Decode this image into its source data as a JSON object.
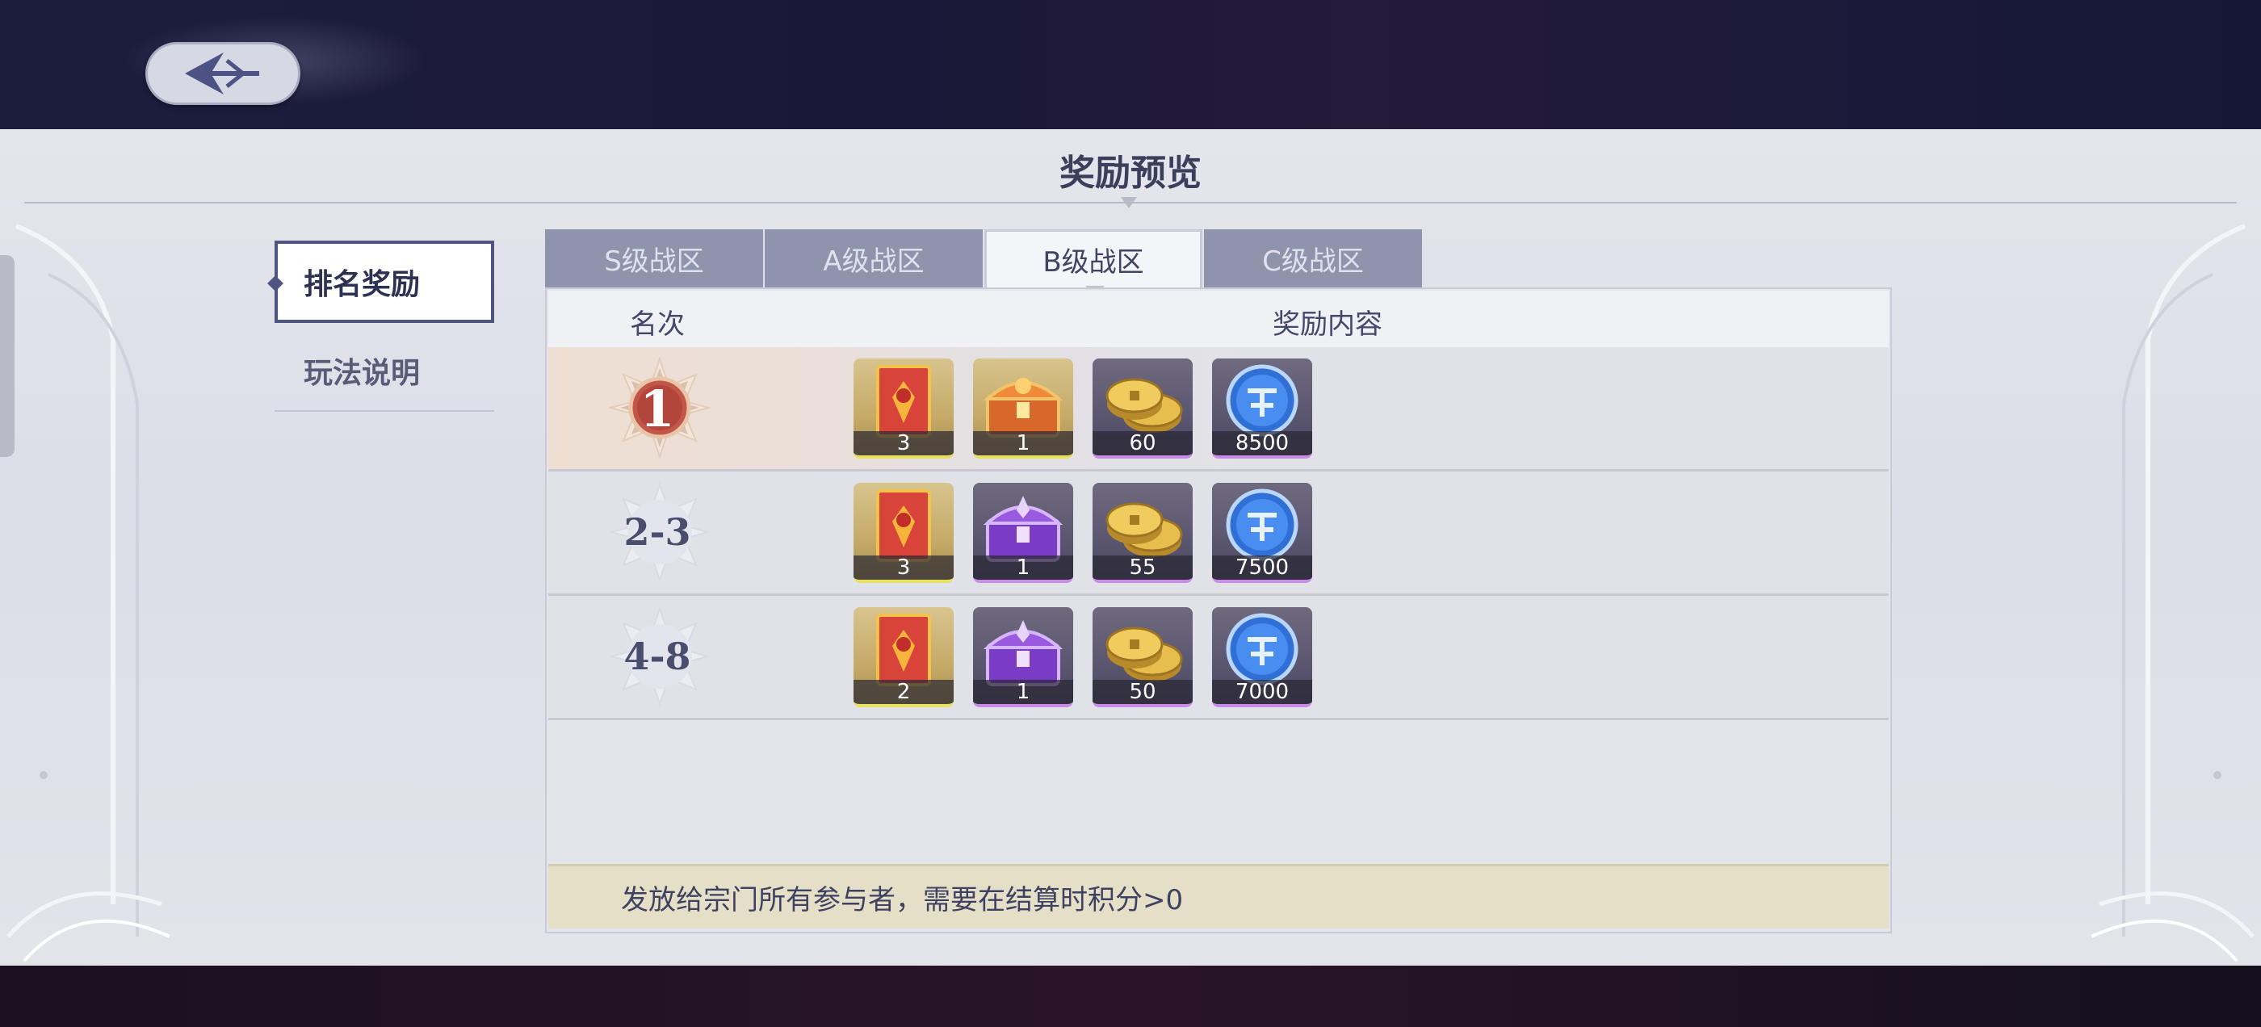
{
  "header": {
    "title": "奖励预览"
  },
  "sidebar": {
    "items": [
      {
        "label": "排名奖励",
        "active": true
      },
      {
        "label": "玩法说明",
        "active": false
      }
    ]
  },
  "zone_tabs": [
    {
      "label": "S级战区",
      "active": false
    },
    {
      "label": "A级战区",
      "active": false
    },
    {
      "label": "B级战区",
      "active": true
    },
    {
      "label": "C级战区",
      "active": false
    }
  ],
  "table": {
    "headers": {
      "rank": "名次",
      "rewards": "奖励内容"
    },
    "rows": [
      {
        "rank": "1",
        "rewards": [
          {
            "icon": "red-banner-icon",
            "count": "3",
            "rarity": "gold"
          },
          {
            "icon": "orange-treasure-chest-icon",
            "count": "1",
            "rarity": "gold"
          },
          {
            "icon": "gold-coins-icon",
            "count": "60",
            "rarity": "purple"
          },
          {
            "icon": "blue-sect-token-icon",
            "count": "8500",
            "rarity": "purple"
          }
        ]
      },
      {
        "rank": "2-3",
        "rewards": [
          {
            "icon": "red-banner-icon",
            "count": "3",
            "rarity": "gold"
          },
          {
            "icon": "purple-treasure-chest-icon",
            "count": "1",
            "rarity": "purple"
          },
          {
            "icon": "gold-coins-icon",
            "count": "55",
            "rarity": "purple"
          },
          {
            "icon": "blue-sect-token-icon",
            "count": "7500",
            "rarity": "purple"
          }
        ]
      },
      {
        "rank": "4-8",
        "rewards": [
          {
            "icon": "red-banner-icon",
            "count": "2",
            "rarity": "gold"
          },
          {
            "icon": "purple-treasure-chest-icon",
            "count": "1",
            "rarity": "purple"
          },
          {
            "icon": "gold-coins-icon",
            "count": "50",
            "rarity": "purple"
          },
          {
            "icon": "blue-sect-token-icon",
            "count": "7000",
            "rarity": "purple"
          }
        ]
      }
    ],
    "footer_note": "发放给宗门所有参与者，需要在结算时积分>0"
  },
  "colors": {
    "panel_bg": "#dcdde6",
    "tab_inactive": "#8f94ad",
    "tab_active": "#f4f5f8",
    "accent": "#4f5580",
    "footer_bg": "#e6dfc8"
  }
}
